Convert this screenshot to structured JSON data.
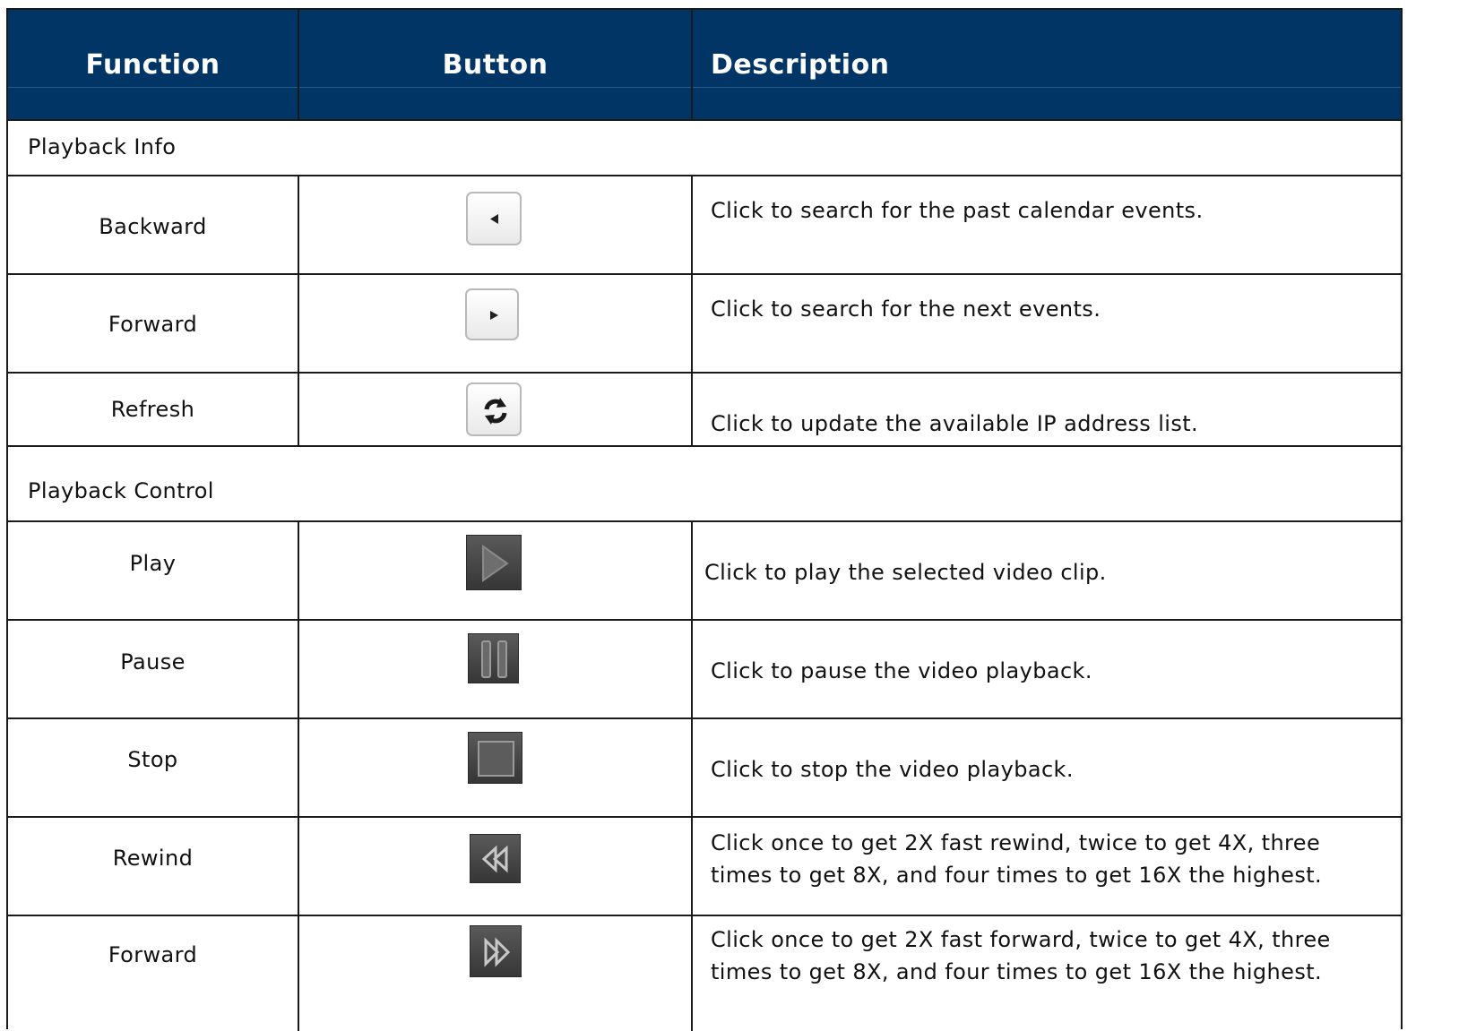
{
  "header": {
    "function": "Function",
    "button": "Button",
    "description": "Description"
  },
  "sections": {
    "info": "Playback Info",
    "control": "Playback Control"
  },
  "rows": [
    {
      "function": "Backward",
      "icon": "backward-arrow-icon",
      "description": "Click to search for the past calendar events."
    },
    {
      "function": "Forward",
      "icon": "forward-arrow-icon",
      "description": "Click to search for the next events."
    },
    {
      "function": "Refresh",
      "icon": "refresh-icon",
      "description": "Click to update the available IP address list."
    },
    {
      "function": "Play",
      "icon": "play-icon",
      "description": "Click to play the selected video clip."
    },
    {
      "function": "Pause",
      "icon": "pause-icon",
      "description": "Click to pause the video playback."
    },
    {
      "function": "Stop",
      "icon": "stop-icon",
      "description": "Click to stop the video playback."
    },
    {
      "function": "Rewind",
      "icon": "rewind-icon",
      "description_line1": "Click once to get 2X fast rewind, twice to get 4X, three",
      "description_line2": "times to get 8X, and four times to get 16X the highest."
    },
    {
      "function": "Forward",
      "icon": "fast-forward-icon",
      "description_line1": "Click once to get 2X fast forward, twice to get 4X, three",
      "description_line2": "times to get 8X, and four times to get 16X the highest."
    }
  ],
  "colors": {
    "header_bg": "#003566",
    "header_text": "#ffffff"
  }
}
